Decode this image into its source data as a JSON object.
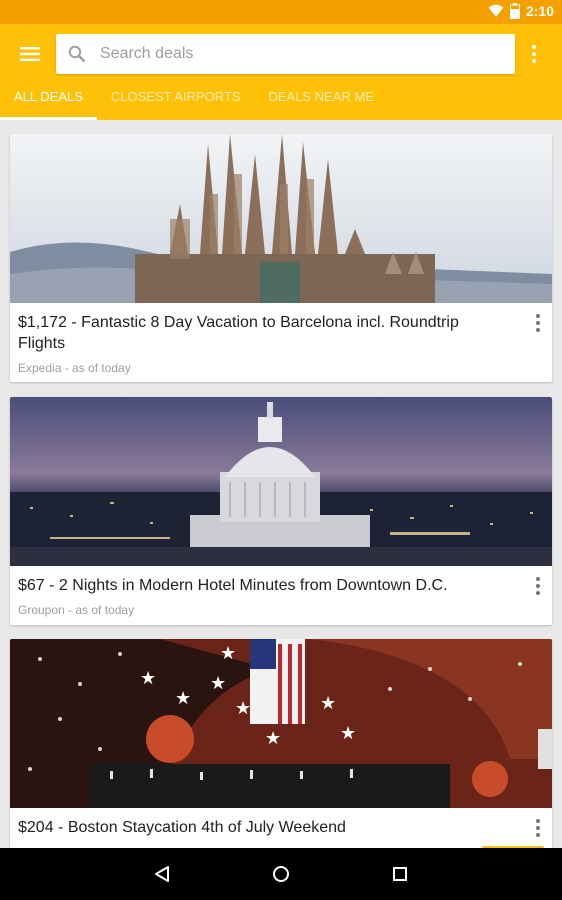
{
  "status_bar": {
    "time": "2:10"
  },
  "search": {
    "placeholder": "Search deals"
  },
  "tabs": [
    {
      "label": "ALL DEALS",
      "active": true
    },
    {
      "label": "CLOSEST AIRPORTS",
      "active": false
    },
    {
      "label": "DEALS NEAR ME",
      "active": false
    }
  ],
  "deals": [
    {
      "title": "$1,172 - Fantastic 8 Day Vacation to Barcelona incl. Roundtrip Flights",
      "source": "Expedia - as of today",
      "image": "sagrada-familia-photo"
    },
    {
      "title": "$67 - 2 Nights in Modern Hotel Minutes from Downtown D.C.",
      "source": "Groupon - as of today",
      "image": "us-capitol-photo"
    },
    {
      "title": "$204 - Boston Staycation 4th of July Weekend",
      "source": "",
      "image": "fireworks-celebration-photo"
    }
  ],
  "colors": {
    "status_bar": "#f5a000",
    "app_bar": "#ffc107",
    "background": "#e8e8e8"
  }
}
